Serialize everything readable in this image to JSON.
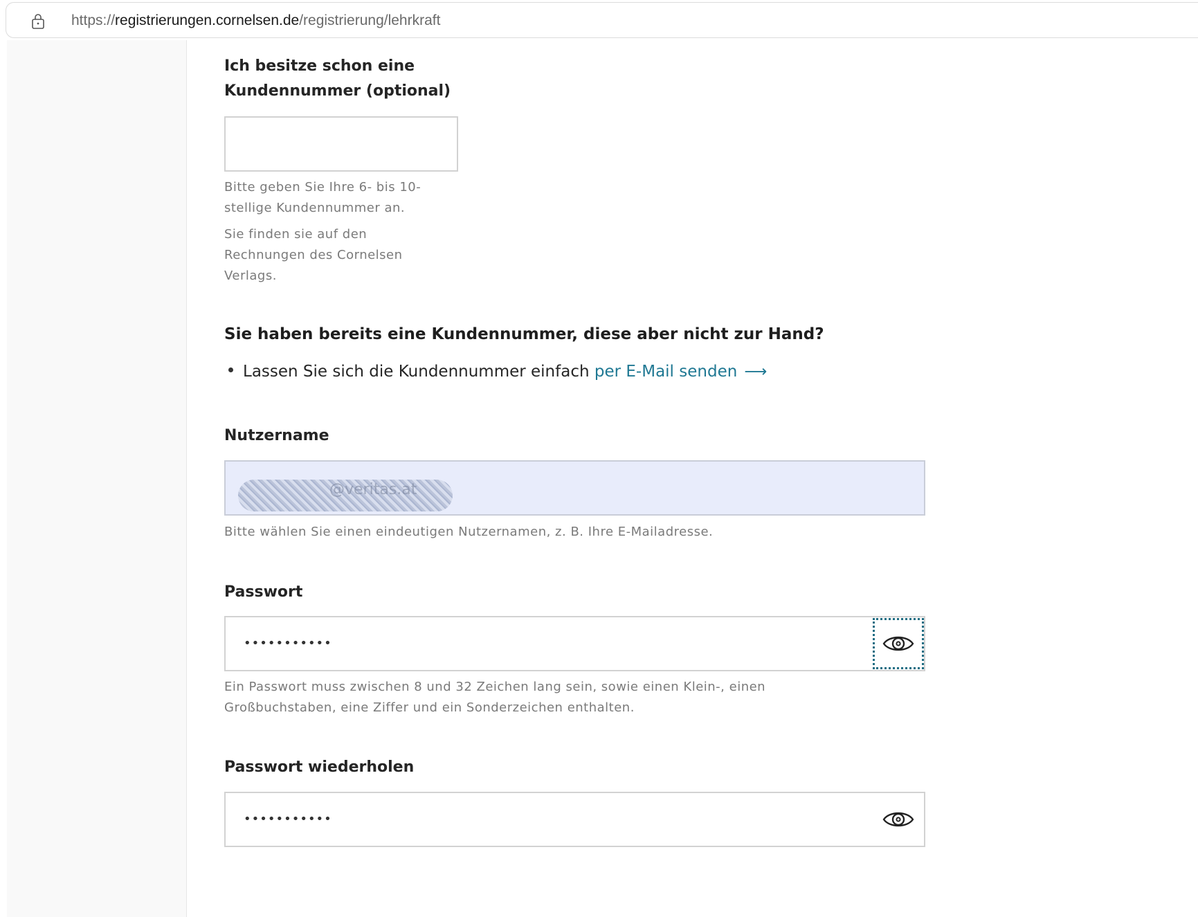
{
  "browser": {
    "url_scheme": "https://",
    "url_host": "registrierungen.cornelsen.de",
    "url_path": "/registrierung/lehrkraft"
  },
  "customer_number": {
    "label_line1": "Ich besitze schon eine",
    "label_line2": "Kundennummer (optional)",
    "value": "",
    "help_line1": "Bitte geben Sie Ihre 6- bis 10-",
    "help_line2": "stellige Kundennummer an.",
    "help_line3": "Sie finden sie auf den",
    "help_line4": "Rechnungen des Cornelsen",
    "help_line5": "Verlags."
  },
  "no_customer_number": {
    "title": "Sie haben bereits eine Kundennummer, diese aber nicht zur Hand?",
    "bullet_text": "Lassen Sie sich die Kundennummer einfach ",
    "link_text": "per E-Mail senden",
    "link_arrow": "⟶"
  },
  "username": {
    "label": "Nutzername",
    "value_visible_fragment": "@veritas.at",
    "help": "Bitte wählen Sie einen eindeutigen Nutzernamen, z. B. Ihre E-Mailadresse."
  },
  "password": {
    "label": "Passwort",
    "value_masked": "•••••••••••",
    "help_line1": "Ein Passwort muss zwischen 8 und 32 Zeichen lang sein, sowie einen Klein-, einen",
    "help_line2": "Großbuchstaben, eine Ziffer und ein Sonderzeichen enthalten."
  },
  "password_repeat": {
    "label": "Passwort wiederholen",
    "value_masked": "•••••••••••"
  },
  "colors": {
    "link": "#1f7893",
    "focus_outline": "#1f6d83",
    "autofill_bg": "#e8ecfb"
  }
}
